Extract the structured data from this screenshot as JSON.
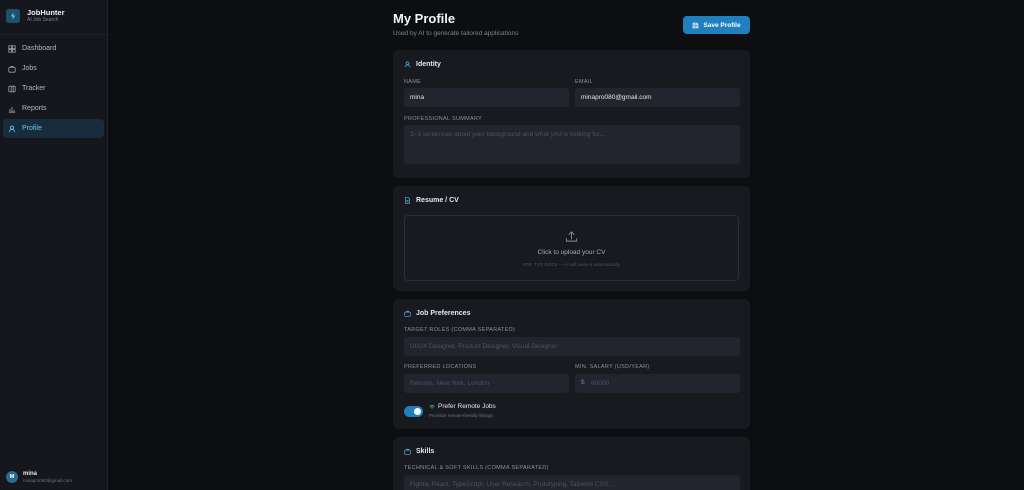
{
  "brand": {
    "name": "JobHunter",
    "subtitle": "AI Job Search"
  },
  "nav": [
    {
      "label": "Dashboard",
      "icon": "dashboard-icon"
    },
    {
      "label": "Jobs",
      "icon": "briefcase-icon"
    },
    {
      "label": "Tracker",
      "icon": "kanban-icon"
    },
    {
      "label": "Reports",
      "icon": "bar-chart-icon"
    },
    {
      "label": "Profile",
      "icon": "user-icon",
      "active": true
    }
  ],
  "user": {
    "initial": "M",
    "name": "mina",
    "email": "minapro080@gmail.com"
  },
  "header": {
    "title": "My Profile",
    "subtitle": "Used by AI to generate tailored applications",
    "save_label": "Save Profile"
  },
  "identity": {
    "title": "Identity",
    "name_label": "NAME",
    "name_value": "mina",
    "email_label": "EMAIL",
    "email_value": "minapro080@gmail.com",
    "summary_label": "PROFESSIONAL SUMMARY",
    "summary_placeholder": "2–3 sentences about your background and what you're looking for..."
  },
  "resume": {
    "title": "Resume / CV",
    "upload_title": "Click to upload your CV",
    "upload_hint": "PDF, TXT, DOCX — AI will parse it automatically"
  },
  "preferences": {
    "title": "Job Preferences",
    "roles_label": "TARGET ROLES (COMMA SEPARATED)",
    "roles_placeholder": "UI/UX Designer, Product Designer, Visual Designer",
    "locations_label": "PREFERRED LOCATIONS",
    "locations_placeholder": "Remote, New York, London",
    "salary_label": "MIN. SALARY (USD/YEAR)",
    "salary_prefix": "$",
    "salary_placeholder": "80000",
    "remote_label": "Prefer Remote Jobs",
    "remote_hint": "Prioritize remote-friendly listings",
    "remote_enabled": true
  },
  "skills": {
    "title": "Skills",
    "skills_label": "TECHNICAL & SOFT SKILLS (COMMA SEPARATED)",
    "skills_placeholder": "Figma, React, TypeScript, User Research, Prototyping, Tailwind CSS..."
  },
  "colors": {
    "accent": "#1f7fbf",
    "active_text": "#6cc4f0",
    "background": "#0d0e12",
    "card": "#181a20"
  }
}
